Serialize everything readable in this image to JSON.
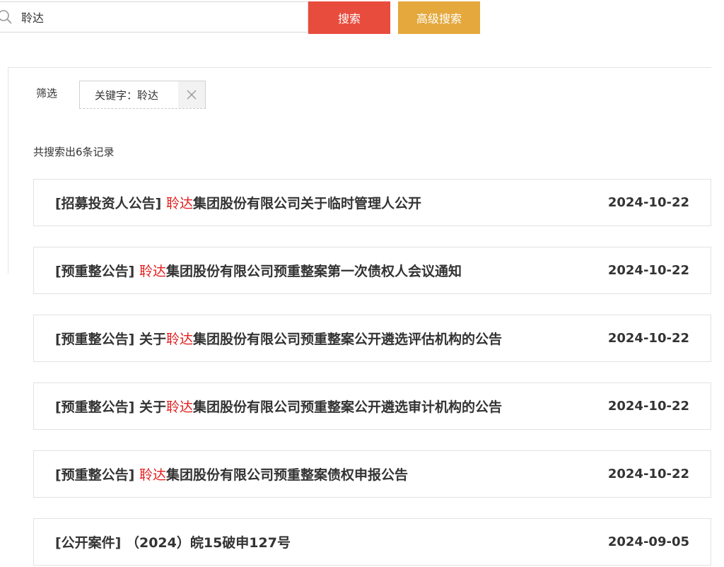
{
  "search": {
    "value": "聆达",
    "button_label": "搜索",
    "advanced_label": "高级搜索"
  },
  "filter": {
    "label": "筛选",
    "chip_text": "关键字：聆达"
  },
  "result_count": "共搜索出6条记录",
  "results": [
    {
      "category": "[招募投资人公告] ",
      "pre": "",
      "highlight": "聆达",
      "post": "集团股份有限公司关于临时管理人公开",
      "date": "2024-10-22"
    },
    {
      "category": "[预重整公告] ",
      "pre": "",
      "highlight": "聆达",
      "post": "集团股份有限公司预重整案第一次债权人会议通知",
      "date": "2024-10-22"
    },
    {
      "category": "[预重整公告] ",
      "pre": "关于",
      "highlight": "聆达",
      "post": "集团股份有限公司预重整案公开遴选评估机构的公告",
      "date": "2024-10-22"
    },
    {
      "category": "[预重整公告] ",
      "pre": "关于",
      "highlight": "聆达",
      "post": "集团股份有限公司预重整案公开遴选审计机构的公告",
      "date": "2024-10-22"
    },
    {
      "category": "[预重整公告] ",
      "pre": "",
      "highlight": "聆达",
      "post": "集团股份有限公司预重整案债权申报公告",
      "date": "2024-10-22"
    },
    {
      "category": "[公开案件] ",
      "pre": "（2024）皖15破申127号",
      "highlight": "",
      "post": "",
      "date": "2024-09-05"
    }
  ],
  "colors": {
    "search_button": "#e84c3d",
    "advanced_button": "#e4a83c",
    "highlight": "#e21e1e"
  }
}
